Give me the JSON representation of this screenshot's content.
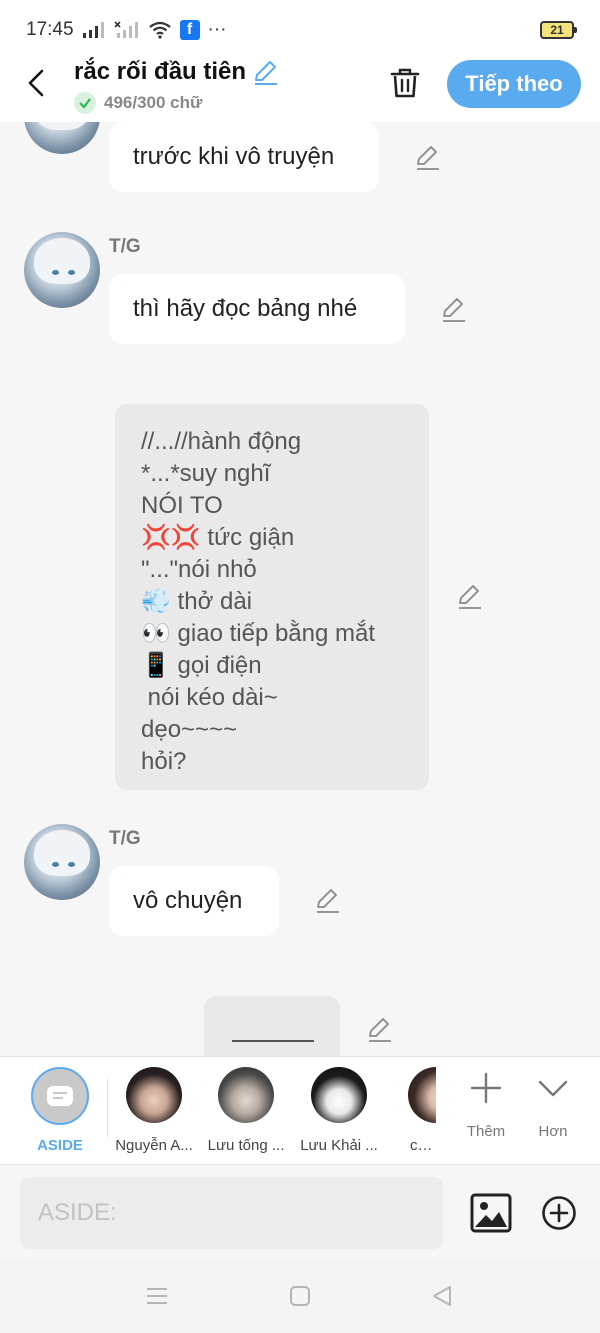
{
  "status_bar": {
    "time": "17:45",
    "facebook_glyph": "f",
    "more": "···",
    "battery": "21"
  },
  "header": {
    "title": "rắc rối đầu tiên",
    "word_count": "496/300 chữ",
    "next_label": "Tiếp theo"
  },
  "messages": [
    {
      "type": "bubble",
      "text": "trước khi vô truyện"
    },
    {
      "type": "bubble",
      "sender": "T/G",
      "text": "thì hãy đọc bảng nhé"
    },
    {
      "type": "aside",
      "lines": [
        "//...//hành động",
        "*...*suy nghĩ",
        "NÓI TO",
        "💢💢 tức giận",
        "\"...\"nói nhỏ",
        "💨 thở dài",
        "👀 giao tiếp bằng mắt",
        "📱 gọi điện",
        " nói kéo dài~",
        "dẹo~~~~",
        "hỏi?"
      ]
    },
    {
      "type": "bubble",
      "sender": "T/G",
      "text": "vô chuyện"
    },
    {
      "type": "aside_blank"
    }
  ],
  "characters": [
    {
      "name": "ASIDE",
      "active": true
    },
    {
      "name": "Nguyễn A..."
    },
    {
      "name": "Lưu tống ..."
    },
    {
      "name": "Lưu Khải ..."
    },
    {
      "name": "cô g"
    }
  ],
  "tools": {
    "add_label": "Thêm",
    "more_label": "Hơn"
  },
  "input": {
    "placeholder": "ASIDE:"
  },
  "colors": {
    "accent": "#5aaaf0",
    "background": "#f6f6f6",
    "bubble": "#ffffff",
    "aside_box": "#e9e9e9"
  }
}
